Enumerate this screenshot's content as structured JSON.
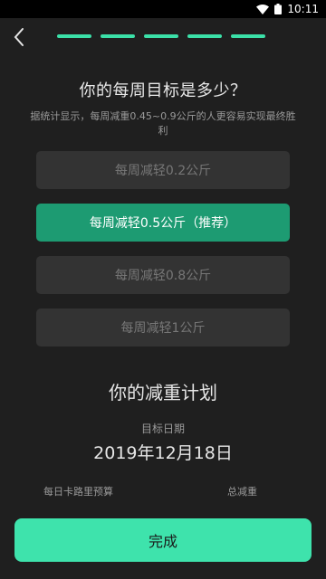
{
  "status_bar": {
    "time": "10:11"
  },
  "progress": {
    "steps_total": 5,
    "steps_completed": 5
  },
  "page": {
    "title": "你的每周目标是多少？",
    "description": "据统计显示，每周减重0.45~0.9公斤的人更容易实现最终胜利"
  },
  "options": [
    {
      "label": "每周减轻0.2公斤",
      "selected": false
    },
    {
      "label": "每周减轻0.5公斤（推荐）",
      "selected": true
    },
    {
      "label": "每周减轻0.8公斤",
      "selected": false
    },
    {
      "label": "每周减轻1公斤",
      "selected": false
    }
  ],
  "plan": {
    "title": "你的减重计划",
    "target_date_label": "目标日期",
    "target_date": "2019年12月18日",
    "daily_budget_label": "每日卡路里预算",
    "total_loss_label": "总减重"
  },
  "done_button": {
    "label": "完成"
  },
  "colors": {
    "accent": "#3ee3ac",
    "selected": "#1d9b72",
    "background": "#1f1f1f",
    "option_bg": "#333333"
  }
}
